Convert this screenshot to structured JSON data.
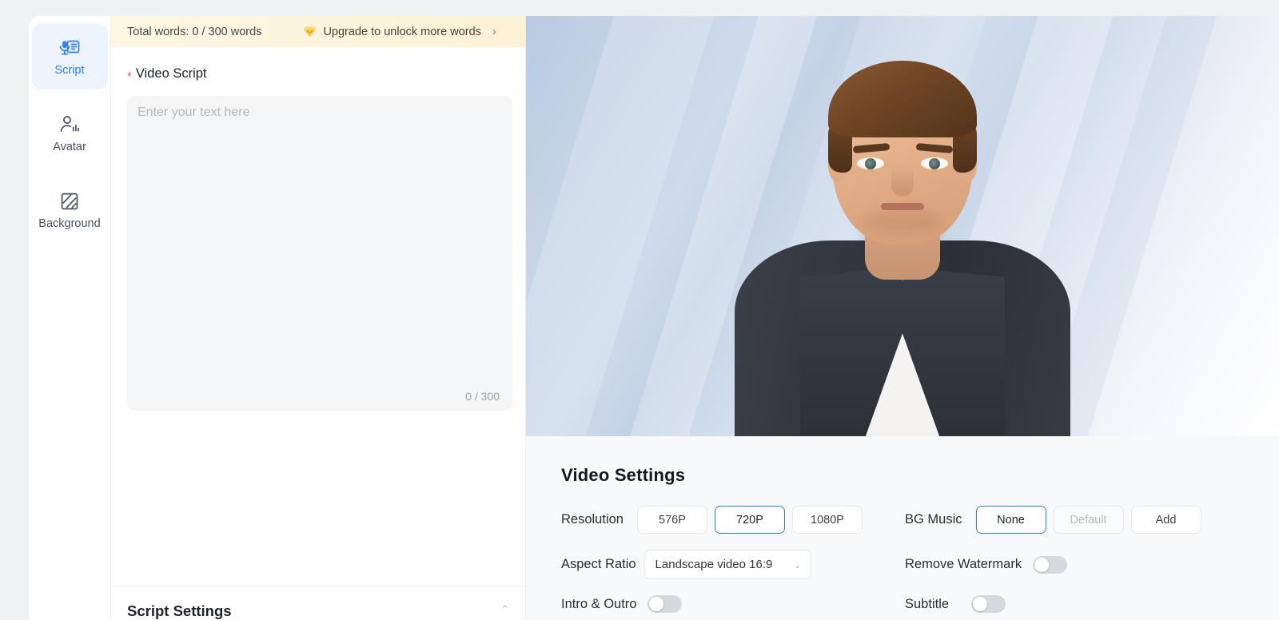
{
  "sidebar": {
    "items": [
      {
        "label": "Script",
        "icon": "script-mic-icon",
        "active": true
      },
      {
        "label": "Avatar",
        "icon": "avatar-person-icon",
        "active": false
      },
      {
        "label": "Background",
        "icon": "background-hatch-icon",
        "active": false
      }
    ]
  },
  "quota": {
    "text": "Total words: 0 / 300 words",
    "upgrade_label": "Upgrade to unlock more words",
    "upgrade_chevron": "›",
    "gem_icon": "gem-icon",
    "accent": "#f5c344"
  },
  "script": {
    "required_marker": "*",
    "label": "Video Script",
    "placeholder": "Enter your text here",
    "value": "",
    "counter": "0 / 300"
  },
  "script_settings": {
    "title": "Script Settings",
    "collapse_chevron": "⌃"
  },
  "preview": {
    "avatar_alt": "male presenter avatar in dark suit with blue striped tie",
    "background_alt": "soft blue-grey diagonal gradient backdrop"
  },
  "settings": {
    "title": "Video Settings",
    "resolution": {
      "label": "Resolution",
      "options": [
        "576P",
        "720P",
        "1080P"
      ],
      "selected": "720P"
    },
    "aspect_ratio": {
      "label": "Aspect Ratio",
      "value": "Landscape video 16:9",
      "chevron": "⌄"
    },
    "intro_outro": {
      "label": "Intro & Outro",
      "on": false
    },
    "bg_music": {
      "label": "BG Music",
      "options": [
        "None",
        "Default",
        "Add"
      ],
      "selected": "None",
      "disabled": [
        "Default"
      ]
    },
    "remove_watermark": {
      "label": "Remove Watermark",
      "on": false
    },
    "subtitle": {
      "label": "Subtitle",
      "on": false
    }
  },
  "colors": {
    "accent_blue": "#2f7cf6",
    "required_red": "#f45b5b",
    "banner_yellow": "#fdf4dd",
    "panel_bg": "#f8f9fb"
  }
}
